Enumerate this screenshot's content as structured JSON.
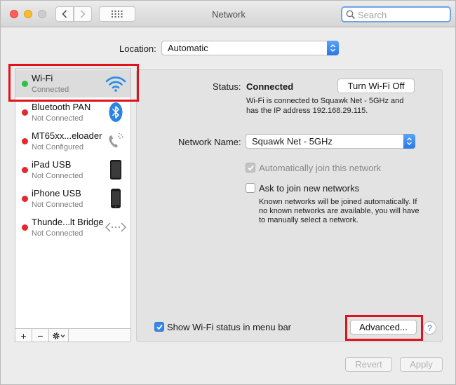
{
  "window": {
    "title": "Network"
  },
  "search": {
    "placeholder": "Search"
  },
  "location": {
    "label": "Location:",
    "value": "Automatic"
  },
  "services": [
    {
      "name": "Wi-Fi",
      "status": "Connected",
      "state": "green",
      "icon": "wifi-icon",
      "selected": true
    },
    {
      "name": "Bluetooth PAN",
      "status": "Not Connected",
      "state": "red",
      "icon": "bluetooth-icon"
    },
    {
      "name": "MT65xx...eloader",
      "status": "Not Configured",
      "state": "red",
      "icon": "phone-handset-icon"
    },
    {
      "name": "iPad USB",
      "status": "Not Connected",
      "state": "red",
      "icon": "ipad-icon"
    },
    {
      "name": "iPhone USB",
      "status": "Not Connected",
      "state": "red",
      "icon": "iphone-icon"
    },
    {
      "name": "Thunde...lt Bridge",
      "status": "Not Connected",
      "state": "red",
      "icon": "bridge-arrows-icon"
    }
  ],
  "footer": {
    "add": "+",
    "remove": "−"
  },
  "status": {
    "label": "Status:",
    "value": "Connected",
    "desc_line1": "Wi-Fi is connected to Squawk Net - 5GHz and",
    "desc_line2": "has the IP address 192.168.29.115."
  },
  "wifi_button": "Turn Wi-Fi Off",
  "network_name": {
    "label": "Network Name:",
    "value": "Squawk Net - 5GHz"
  },
  "auto_join": {
    "label": "Automatically join this network",
    "checked": true
  },
  "ask_join": {
    "label": "Ask to join new networks",
    "checked": false,
    "note_line1": "Known networks will be joined automatically. If",
    "note_line2": "no known networks are available, you will have",
    "note_line3": "to manually select a network."
  },
  "show_status": {
    "label": "Show Wi-Fi status in menu bar",
    "checked": true
  },
  "advanced_button": "Advanced...",
  "help_button": "?",
  "revert_button": "Revert",
  "apply_button": "Apply",
  "colors": {
    "accent": "#3b86ea",
    "highlight": "#e0121a",
    "connected": "#2ec23f",
    "disconnected": "#e5282f"
  }
}
